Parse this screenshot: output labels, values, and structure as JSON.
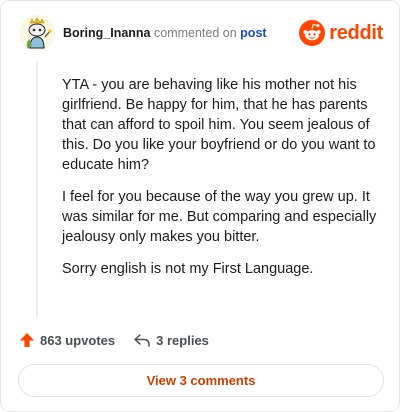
{
  "comment": {
    "username": "Boring_Inanna",
    "action_text": "commented on",
    "post_link_label": "post",
    "paragraphs": [
      "YTA - you are behaving like his mother not his girlfriend. Be happy for him, that he has parents that can afford to spoil him. You seem jealous of this. Do you like your boyfriend or do you want to educate him?",
      "I feel for you because of the way you grew up. It was similar for me. But comparing and especially jealousy only makes you bitter.",
      "Sorry english is not my First Language."
    ]
  },
  "brand": {
    "name": "reddit",
    "color": "#ff4500"
  },
  "stats": {
    "upvotes_label": "863 upvotes",
    "replies_label": "3 replies"
  },
  "footer": {
    "view_comments_label": "View 3 comments"
  },
  "icons": {
    "avatar": "snoo-avatar",
    "brand": "reddit-logo-icon",
    "upvote": "upvote-arrow-icon",
    "reply": "reply-arrow-icon"
  }
}
